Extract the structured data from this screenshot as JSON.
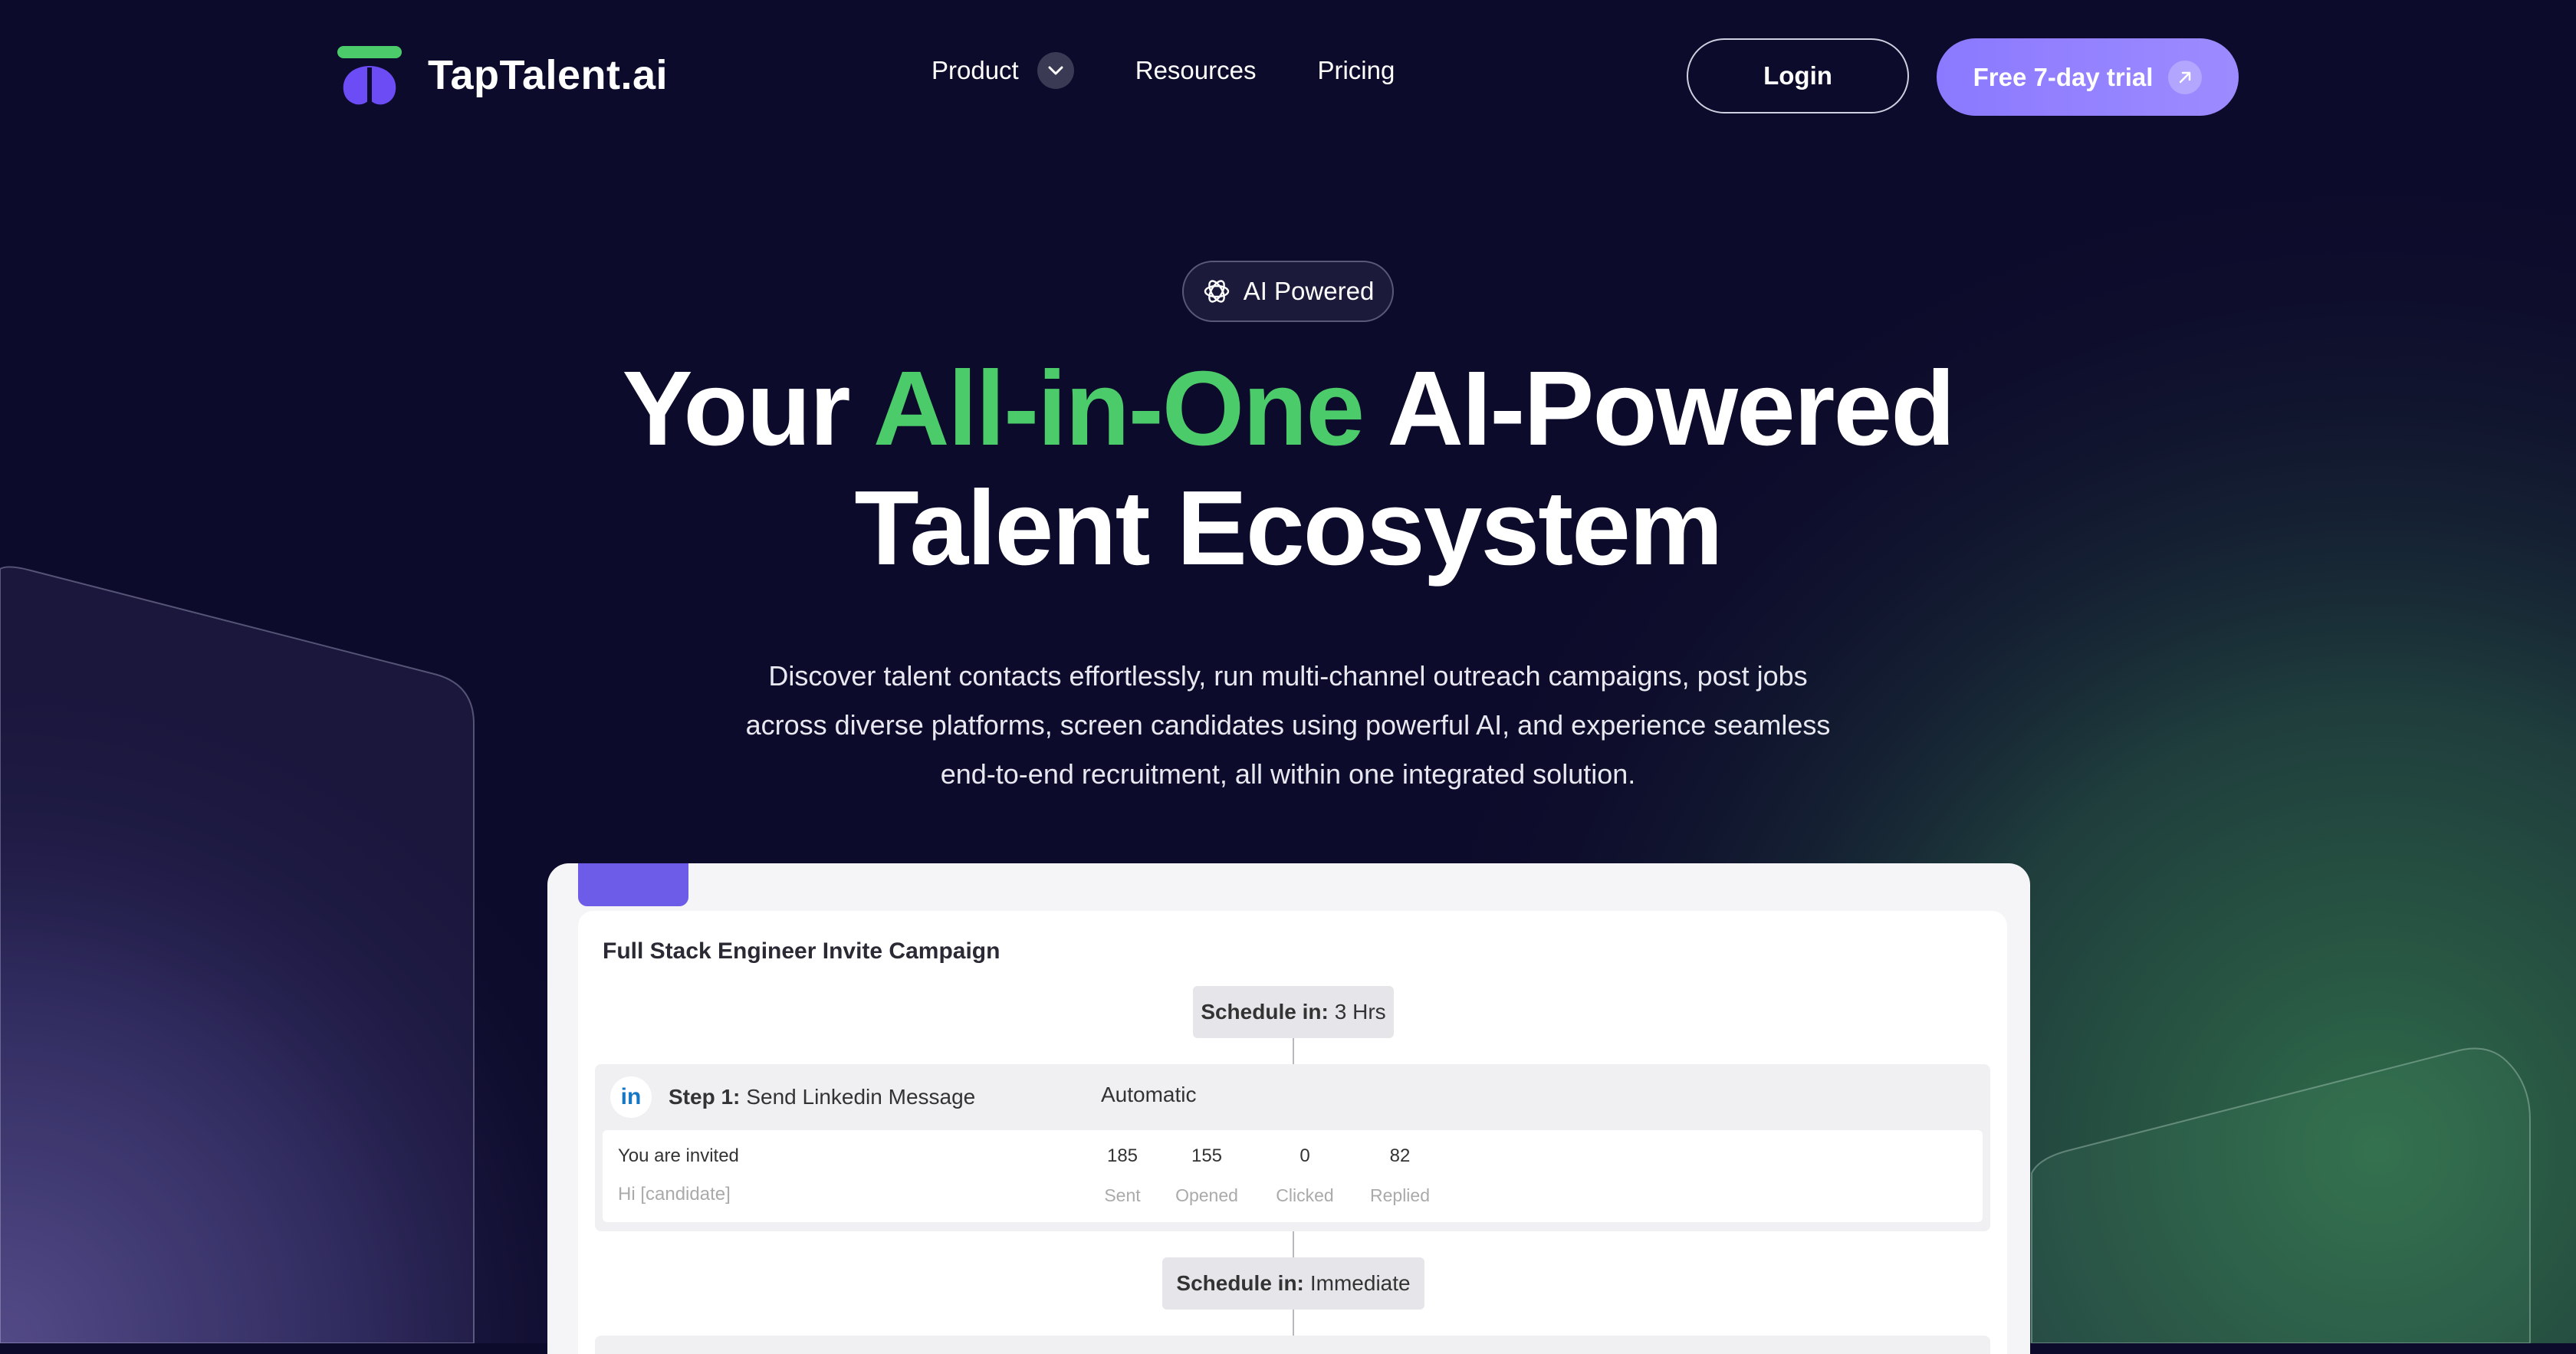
{
  "brand": {
    "name": "TapTalent.ai"
  },
  "nav": {
    "items": [
      {
        "label": "Product",
        "has_dropdown": true
      },
      {
        "label": "Resources"
      },
      {
        "label": "Pricing"
      }
    ],
    "login_label": "Login",
    "trial_label": "Free 7-day trial"
  },
  "hero": {
    "badge": "AI Powered",
    "headline_pre": "Your ",
    "headline_accent": "All-in-One",
    "headline_post": " AI-Powered",
    "headline_line2": "Talent Ecosystem",
    "subtitle_lines": [
      "Discover talent contacts effortlessly, run multi-channel outreach campaigns, post jobs",
      "across diverse platforms, screen candidates using powerful AI, and experience seamless",
      "end-to-end recruitment, all within one integrated solution."
    ]
  },
  "campaign": {
    "title": "Full Stack Engineer Invite Campaign",
    "schedule1": {
      "label": "Schedule in:",
      "value": "3 Hrs"
    },
    "step": {
      "prefix": "Step 1:",
      "name": "Send Linkedin Message",
      "mode": "Automatic",
      "message_title": "You are invited",
      "message_preview": "Hi [candidate]",
      "stats": [
        {
          "value": "185",
          "label": "Sent"
        },
        {
          "value": "155",
          "label": "Opened"
        },
        {
          "value": "0",
          "label": "Clicked"
        },
        {
          "value": "82",
          "label": "Replied"
        }
      ]
    },
    "schedule2": {
      "label": "Schedule in:",
      "value": "Immediate"
    }
  },
  "colors": {
    "background": "#0d0b2b",
    "accent_green": "#4ccb6a",
    "accent_purple": "#8b79ff",
    "linkedin_blue": "#1677c5"
  },
  "icons": [
    "logo-icon",
    "chevron-down-icon",
    "arrow-up-right-icon",
    "openai-icon",
    "linkedin-icon"
  ]
}
